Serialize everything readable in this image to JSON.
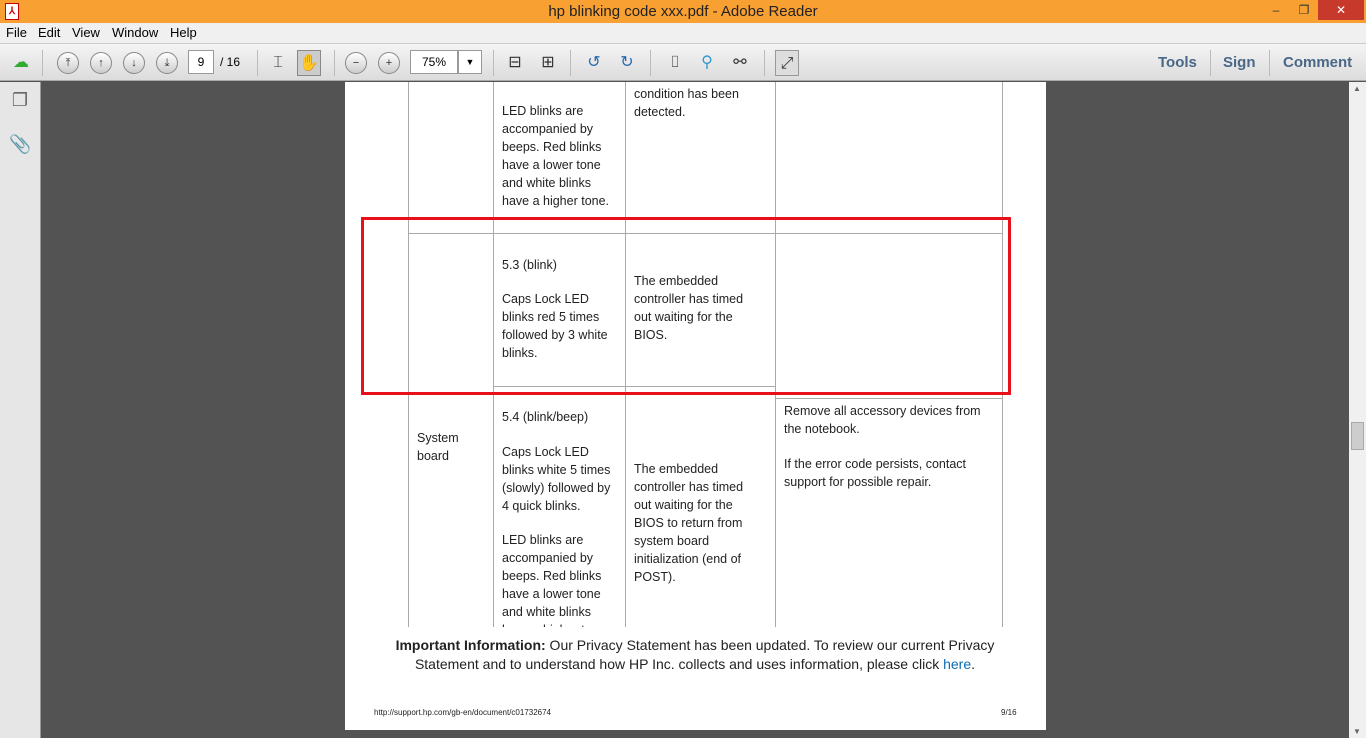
{
  "window": {
    "title": "hp blinking code xxx.pdf - Adobe Reader",
    "minimize": "‒",
    "restore": "❐",
    "close": "✕"
  },
  "menu": [
    "File",
    "Edit",
    "View",
    "Window",
    "Help"
  ],
  "toolbar": {
    "page": "9",
    "page_total": "/ 16",
    "zoom": "75%",
    "tools": "Tools",
    "sign": "Sign",
    "comment": "Comment"
  },
  "table": {
    "row_prev": {
      "blink": "LED blinks are accompanied by beeps. Red blinks have a lower tone and white blinks have a higher tone.",
      "meaning": "condition has been detected."
    },
    "row_53": {
      "code": "5.3 (blink)",
      "blink": "Caps Lock LED blinks red 5 times followed by 3 white blinks.",
      "meaning": "The embedded controller has timed out waiting for the BIOS."
    },
    "row_54": {
      "component": "System board",
      "code": "5.4 (blink/beep)",
      "blink": "Caps Lock LED blinks white 5 times (slowly) followed by 4 quick blinks.",
      "blink2": "LED blinks are accompanied by beeps. Red blinks have a lower tone and white blinks have a higher tone.",
      "meaning": "The embedded controller has timed out waiting for the BIOS to return from system board initialization (end of POST).",
      "action1": "Remove all accessory devices from the notebook.",
      "action2": "If the error code persists, contact support for possible repair."
    }
  },
  "notice": {
    "bold": "Important Information:",
    "text": " Our Privacy Statement has been updated. To review our current Privacy Statement and to understand how HP Inc. collects and uses information, please click ",
    "link": "here",
    "end": "."
  },
  "footer": {
    "url": "http://support.hp.com/gb-en/document/c01732674",
    "page": "9/16"
  },
  "colors": {
    "title_bar": "#f9a033",
    "highlight": "#e8111a",
    "link": "#0a6eb4"
  }
}
